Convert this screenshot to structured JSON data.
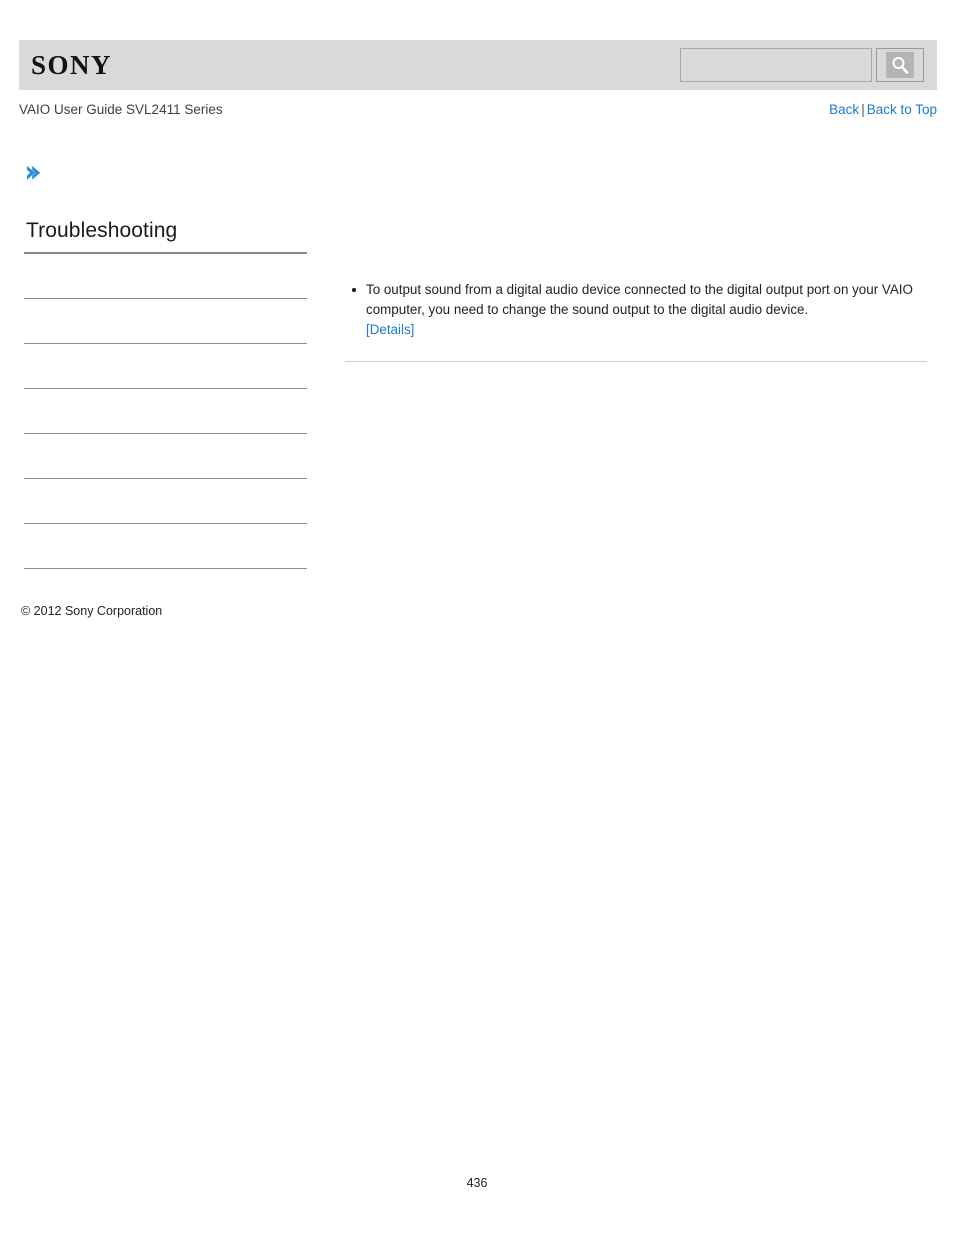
{
  "header": {
    "logo_text": "SONY",
    "search": {
      "value": "",
      "placeholder": "",
      "icon": "search-icon"
    }
  },
  "title_row": {
    "guide_title": "VAIO User Guide SVL2411 Series",
    "back_label": "Back",
    "separator": "|",
    "back_to_top_label": "Back to Top"
  },
  "breadcrumb": {
    "arrow_icon": "chevron-right-icon"
  },
  "sidebar": {
    "heading": "Troubleshooting",
    "items": [
      {
        "label": ""
      },
      {
        "label": ""
      },
      {
        "label": ""
      },
      {
        "label": ""
      },
      {
        "label": ""
      },
      {
        "label": ""
      },
      {
        "label": ""
      }
    ],
    "copyright": "© 2012 Sony Corporation"
  },
  "content": {
    "bullets": [
      {
        "text": "To output sound from a digital audio device connected to the digital output port on your VAIO computer, you need to change the sound output to the digital audio device.",
        "link_label": "[Details]"
      }
    ]
  },
  "footer": {
    "page_number": "436"
  },
  "colors": {
    "header_band": "#d9d9d9",
    "link_blue": "#1a7ad4",
    "rule_gray": "#8c8c8c",
    "content_rule": "#cfcfcf",
    "text": "#231f20"
  }
}
